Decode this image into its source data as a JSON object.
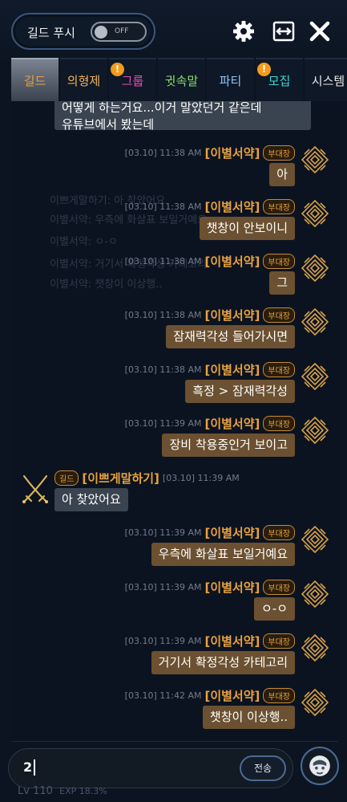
{
  "topbar": {
    "push_label": "길드 푸시",
    "push_state": "OFF",
    "icons": [
      "gear-icon",
      "expand-horizontal-icon",
      "close-icon"
    ]
  },
  "tabs": [
    {
      "label": "길드",
      "color": "#e8a23f",
      "active": true,
      "badge": false
    },
    {
      "label": "의형제",
      "color": "#f2b35b",
      "active": false,
      "badge": false
    },
    {
      "label": "그룹",
      "color": "#e64fb8",
      "active": false,
      "badge": true
    },
    {
      "label": "귓속말",
      "color": "#8ae06a",
      "active": false,
      "badge": false
    },
    {
      "label": "파티",
      "color": "#8fc7ff",
      "active": false,
      "badge": false
    },
    {
      "label": "모집",
      "color": "#40d6d2",
      "active": false,
      "badge": true
    },
    {
      "label": "시스템",
      "color": "#e9e9e9",
      "active": false,
      "badge": false
    }
  ],
  "badge_symbol": "!",
  "previous_message": {
    "line1": "어떻게 하는거요...이거 말았던거 같은데",
    "line2": "유튜브에서 봤는데"
  },
  "background_text": [
    "이쁘게말하기: 아 찾았어요",
    "이별서약: 우측에 화살표 보일거예요",
    "이별서약: ㅇ-ㅇ",
    "이별서약: 거기서 확정각성 카테고리",
    "이별서약: 챗창이 이상행.."
  ],
  "messages": [
    {
      "side": "right",
      "time": "[03.10] 11:38 AM",
      "name": "[이별서약]",
      "rank": "부대장",
      "text": "아"
    },
    {
      "side": "right",
      "time": "[03.10] 11:38 AM",
      "name": "[이별서약]",
      "rank": "부대장",
      "text": "챗창이 안보이니"
    },
    {
      "side": "right",
      "time": "[03.10] 11:38 AM",
      "name": "[이별서약]",
      "rank": "부대장",
      "text": "그"
    },
    {
      "side": "right",
      "time": "[03.10] 11:38 AM",
      "name": "[이별서약]",
      "rank": "부대장",
      "text": "잠재력각성 들어가시면"
    },
    {
      "side": "right",
      "time": "[03.10] 11:38 AM",
      "name": "[이별서약]",
      "rank": "부대장",
      "text": "흑정 > 잠재력각성"
    },
    {
      "side": "right",
      "time": "[03.10] 11:39 AM",
      "name": "[이별서약]",
      "rank": "부대장",
      "text": "장비 착용중인거 보이고"
    },
    {
      "side": "left",
      "time": "[03.10] 11:39 AM",
      "name": "[이쁘게말하기]",
      "rank": "길드",
      "text": "아 찾았어요"
    },
    {
      "side": "right",
      "time": "[03.10] 11:39 AM",
      "name": "[이별서약]",
      "rank": "부대장",
      "text": "우측에 화살표 보일거예요"
    },
    {
      "side": "right",
      "time": "[03.10] 11:39 AM",
      "name": "[이별서약]",
      "rank": "부대장",
      "text": "ㅇ-ㅇ"
    },
    {
      "side": "right",
      "time": "[03.10] 11:39 AM",
      "name": "[이별서약]",
      "rank": "부대장",
      "text": "거기서 확정각성 카테고리"
    },
    {
      "side": "right",
      "time": "[03.10] 11:42 AM",
      "name": "[이별서약]",
      "rank": "부대장",
      "text": "챗창이 이상행.."
    }
  ],
  "input": {
    "value": "2",
    "send_label": "전송"
  },
  "footer": {
    "level": "Lv 110",
    "exp": "EXP 18.3%"
  },
  "colors": {
    "name": "#e8a23f",
    "bubble_right": "#6b5131",
    "bubble_left": "#3a4350",
    "accent_border": "#4b6a92"
  }
}
